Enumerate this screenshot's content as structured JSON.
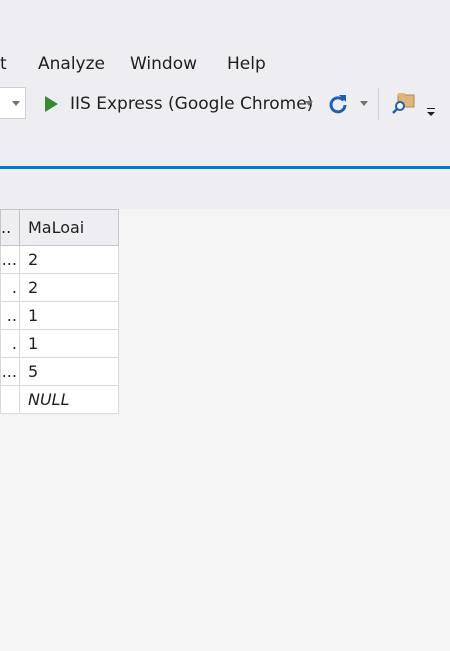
{
  "menu": {
    "partial_item": "t",
    "analyze": "Analyze",
    "window": "Window",
    "help": "Help"
  },
  "toolbar": {
    "run_target": "IIS Express (Google Chrome)",
    "icons": [
      "play-icon",
      "refresh-icon",
      "find-in-files-icon",
      "toolbar-overflow-icon"
    ],
    "accent_color": "#007acc",
    "run_color": "#388a34"
  },
  "grid": {
    "header_partial": "..",
    "column_header": "MaLoai",
    "rows": [
      {
        "cut": "...",
        "maloai": "2"
      },
      {
        "cut": ".",
        "maloai": "2"
      },
      {
        "cut": "..",
        "maloai": "1"
      },
      {
        "cut": ".",
        "maloai": "1"
      },
      {
        "cut": "...",
        "maloai": "5"
      },
      {
        "cut": "",
        "maloai": "NULL"
      }
    ]
  }
}
